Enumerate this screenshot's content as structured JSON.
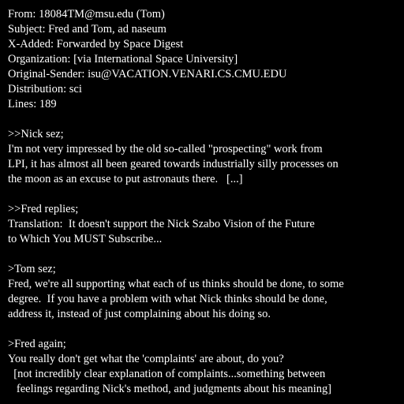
{
  "header": {
    "from": "From: 18084TM@msu.edu (Tom)",
    "subject": "Subject: Fred and Tom, ad naseum",
    "x_added": "X-Added: Forwarded by Space Digest",
    "organization": "Organization: [via International Space University]",
    "original_sender": "Original-Sender: isu@VACATION.VENARI.CS.CMU.EDU",
    "distribution": "Distribution: sci",
    "lines": "Lines: 189"
  },
  "body": {
    "nick": {
      "attribution": ">>Nick sez;",
      "lines": [
        "I'm not very impressed by the old so-called \"prospecting\" work from",
        "LPI, it has almost all been geared towards industrially silly processes on",
        "the moon as an excuse to put astronauts there.   [...]"
      ]
    },
    "fred": {
      "attribution": ">>Fred replies;",
      "lines": [
        "Translation:  It doesn't support the Nick Szabo Vision of the Future",
        "to Which You MUST Subscribe..."
      ]
    },
    "tom": {
      "attribution": ">Tom sez;",
      "lines": [
        "Fred, we're all supporting what each of us thinks should be done, to some",
        "degree.  If you have a problem with what Nick thinks should be done,",
        "address it, instead of just complaining about his doing so."
      ]
    },
    "fred_again": {
      "attribution": ">Fred again;",
      "lines": [
        "You really don't get what the 'complaints' are about, do you?",
        "  [not incredibly clear explanation of complaints...something between",
        "   feelings regarding Nick's method, and judgments about his meaning]"
      ]
    }
  },
  "colors": {
    "background": "#000000",
    "text": "#ffffff"
  }
}
